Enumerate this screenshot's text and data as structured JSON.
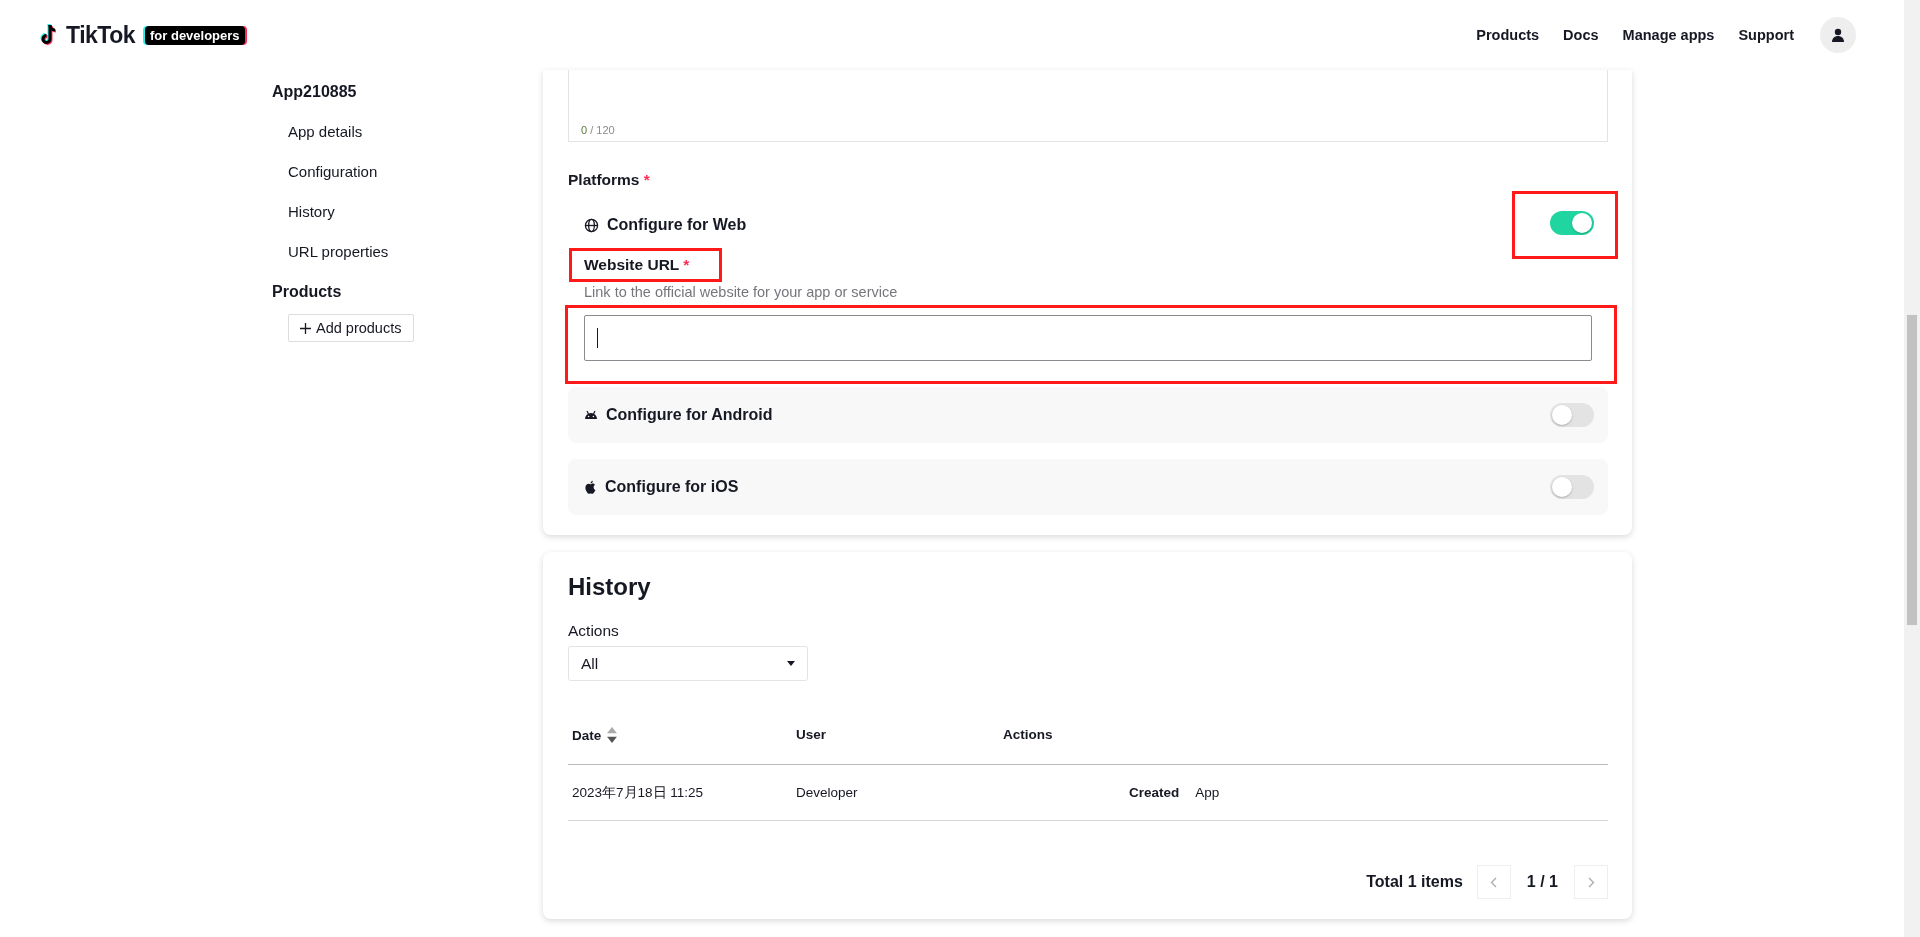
{
  "header": {
    "wordmark": "TikTok",
    "badge": "for developers",
    "nav": [
      "Products",
      "Docs",
      "Manage apps",
      "Support"
    ]
  },
  "sidebar": {
    "app_name": "App210885",
    "items": [
      "App details",
      "Configuration",
      "History",
      "URL properties"
    ],
    "section": "Products",
    "add_button": "Add products"
  },
  "description": {
    "count": "0",
    "limit": "/ 120"
  },
  "platforms": {
    "label": "Platforms",
    "required_mark": "*",
    "items": [
      {
        "kind": "web",
        "label": "Configure for Web",
        "on": true,
        "highlighted": true,
        "url_label": "Website URL",
        "url_required_mark": "*",
        "url_label_highlighted": true,
        "hint": "Link to the official website for your app or service",
        "url_focused": true,
        "url_highlighted": true
      },
      {
        "kind": "android",
        "label": "Configure for Android",
        "on": false,
        "highlighted": false
      },
      {
        "kind": "ios",
        "label": "Configure for iOS",
        "on": false,
        "highlighted": false
      }
    ]
  },
  "history": {
    "title": "History",
    "filter_label": "Actions",
    "filter_value": "All",
    "columns": [
      {
        "label": "Date",
        "sortable": true
      },
      {
        "label": "User",
        "sortable": false
      },
      {
        "label": "Actions",
        "sortable": false
      }
    ],
    "rows": [
      {
        "date": "2023年7月18日 11:25",
        "user": "Developer",
        "action": "Created",
        "target": "App"
      }
    ],
    "total": "Total 1 items",
    "page": "1 / 1",
    "prev_disabled": true,
    "next_disabled": true
  }
}
